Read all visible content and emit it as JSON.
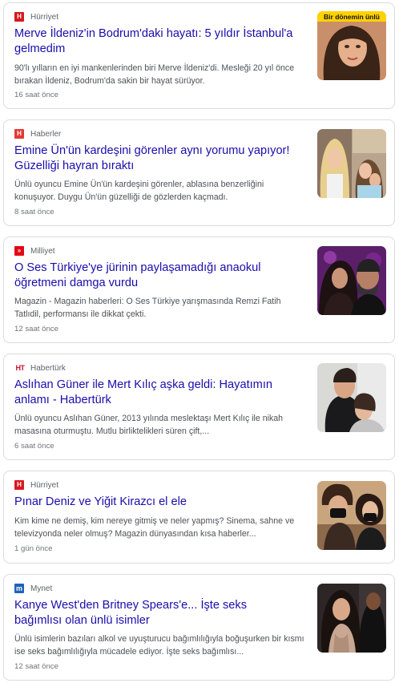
{
  "articles": [
    {
      "source": "Hürriyet",
      "logo_text": "H",
      "logo_color": "#d71920",
      "title": "Merve İldeniz'in Bodrum'daki hayatı: 5 yıldır İstanbul'a gelmedim",
      "snippet": "90'lı yılların en iyi mankenlerinden biri Merve İldeniz'di. Mesleği 20 yıl önce bırakan İldeniz, Bodrum'da sakin bir hayat sürüyor.",
      "time": "16 saat önce",
      "thumb_caption": "Bir dönemin ünlü"
    },
    {
      "source": "Haberler",
      "logo_text": "H",
      "logo_color": "#e53935",
      "title": "Emine Ün'ün kardeşini görenler aynı yorumu yapıyor! Güzelliği hayran bıraktı",
      "snippet": "Ünlü oyuncu Emine Ün'ün kardeşini görenler, ablasına benzerliğini konuşuyor. Duygu Ün'ün güzelliği de gözlerden kaçmadı.",
      "time": "8 saat önce"
    },
    {
      "source": "Milliyet",
      "logo_text": "»",
      "logo_color": "#e30613",
      "title": "O Ses Türkiye'ye jürinin paylaşamadığı anaokul öğretmeni damga vurdu",
      "snippet": "Magazin - Magazin haberleri: O Ses Türkiye yarışmasında Remzi Fatih Tatlıdil, performansı ile dikkat çekti.",
      "time": "12 saat önce"
    },
    {
      "source": "Habertürk",
      "logo_text": "HT",
      "logo_color": "#c8102e",
      "title": "Aslıhan Güner ile Mert Kılıç aşka geldi: Hayatımın anlamı - Habertürk",
      "snippet": "Ünlü oyuncu Aslıhan Güner, 2013 yılında meslektaşı Mert Kılıç ile nikah masasına oturmuştu. Mutlu birliktelikleri süren çift,...",
      "time": "6 saat önce"
    },
    {
      "source": "Hürriyet",
      "logo_text": "H",
      "logo_color": "#d71920",
      "title": "Pınar Deniz ve Yiğit Kirazcı el ele",
      "snippet": "Kim kime ne demiş, kim nereye gitmiş ve neler yapmış? Sinema, sahne ve televizyonda neler olmuş? Magazin dünyasından kısa haberler...",
      "time": "1 gün önce"
    },
    {
      "source": "Mynet",
      "logo_text": "m",
      "logo_color": "#1e63b6",
      "title": "Kanye West'den Britney Spears'e... İşte seks bağımlısı olan ünlü isimler",
      "snippet": "Ünlü isimlerin bazıları alkol ve uyuşturucu bağımlılığıyla boğuşurken bir kısmı ise seks bağımlılığıyla mücadele ediyor. İşte seks bağımlısı...",
      "time": "12 saat önce"
    }
  ]
}
